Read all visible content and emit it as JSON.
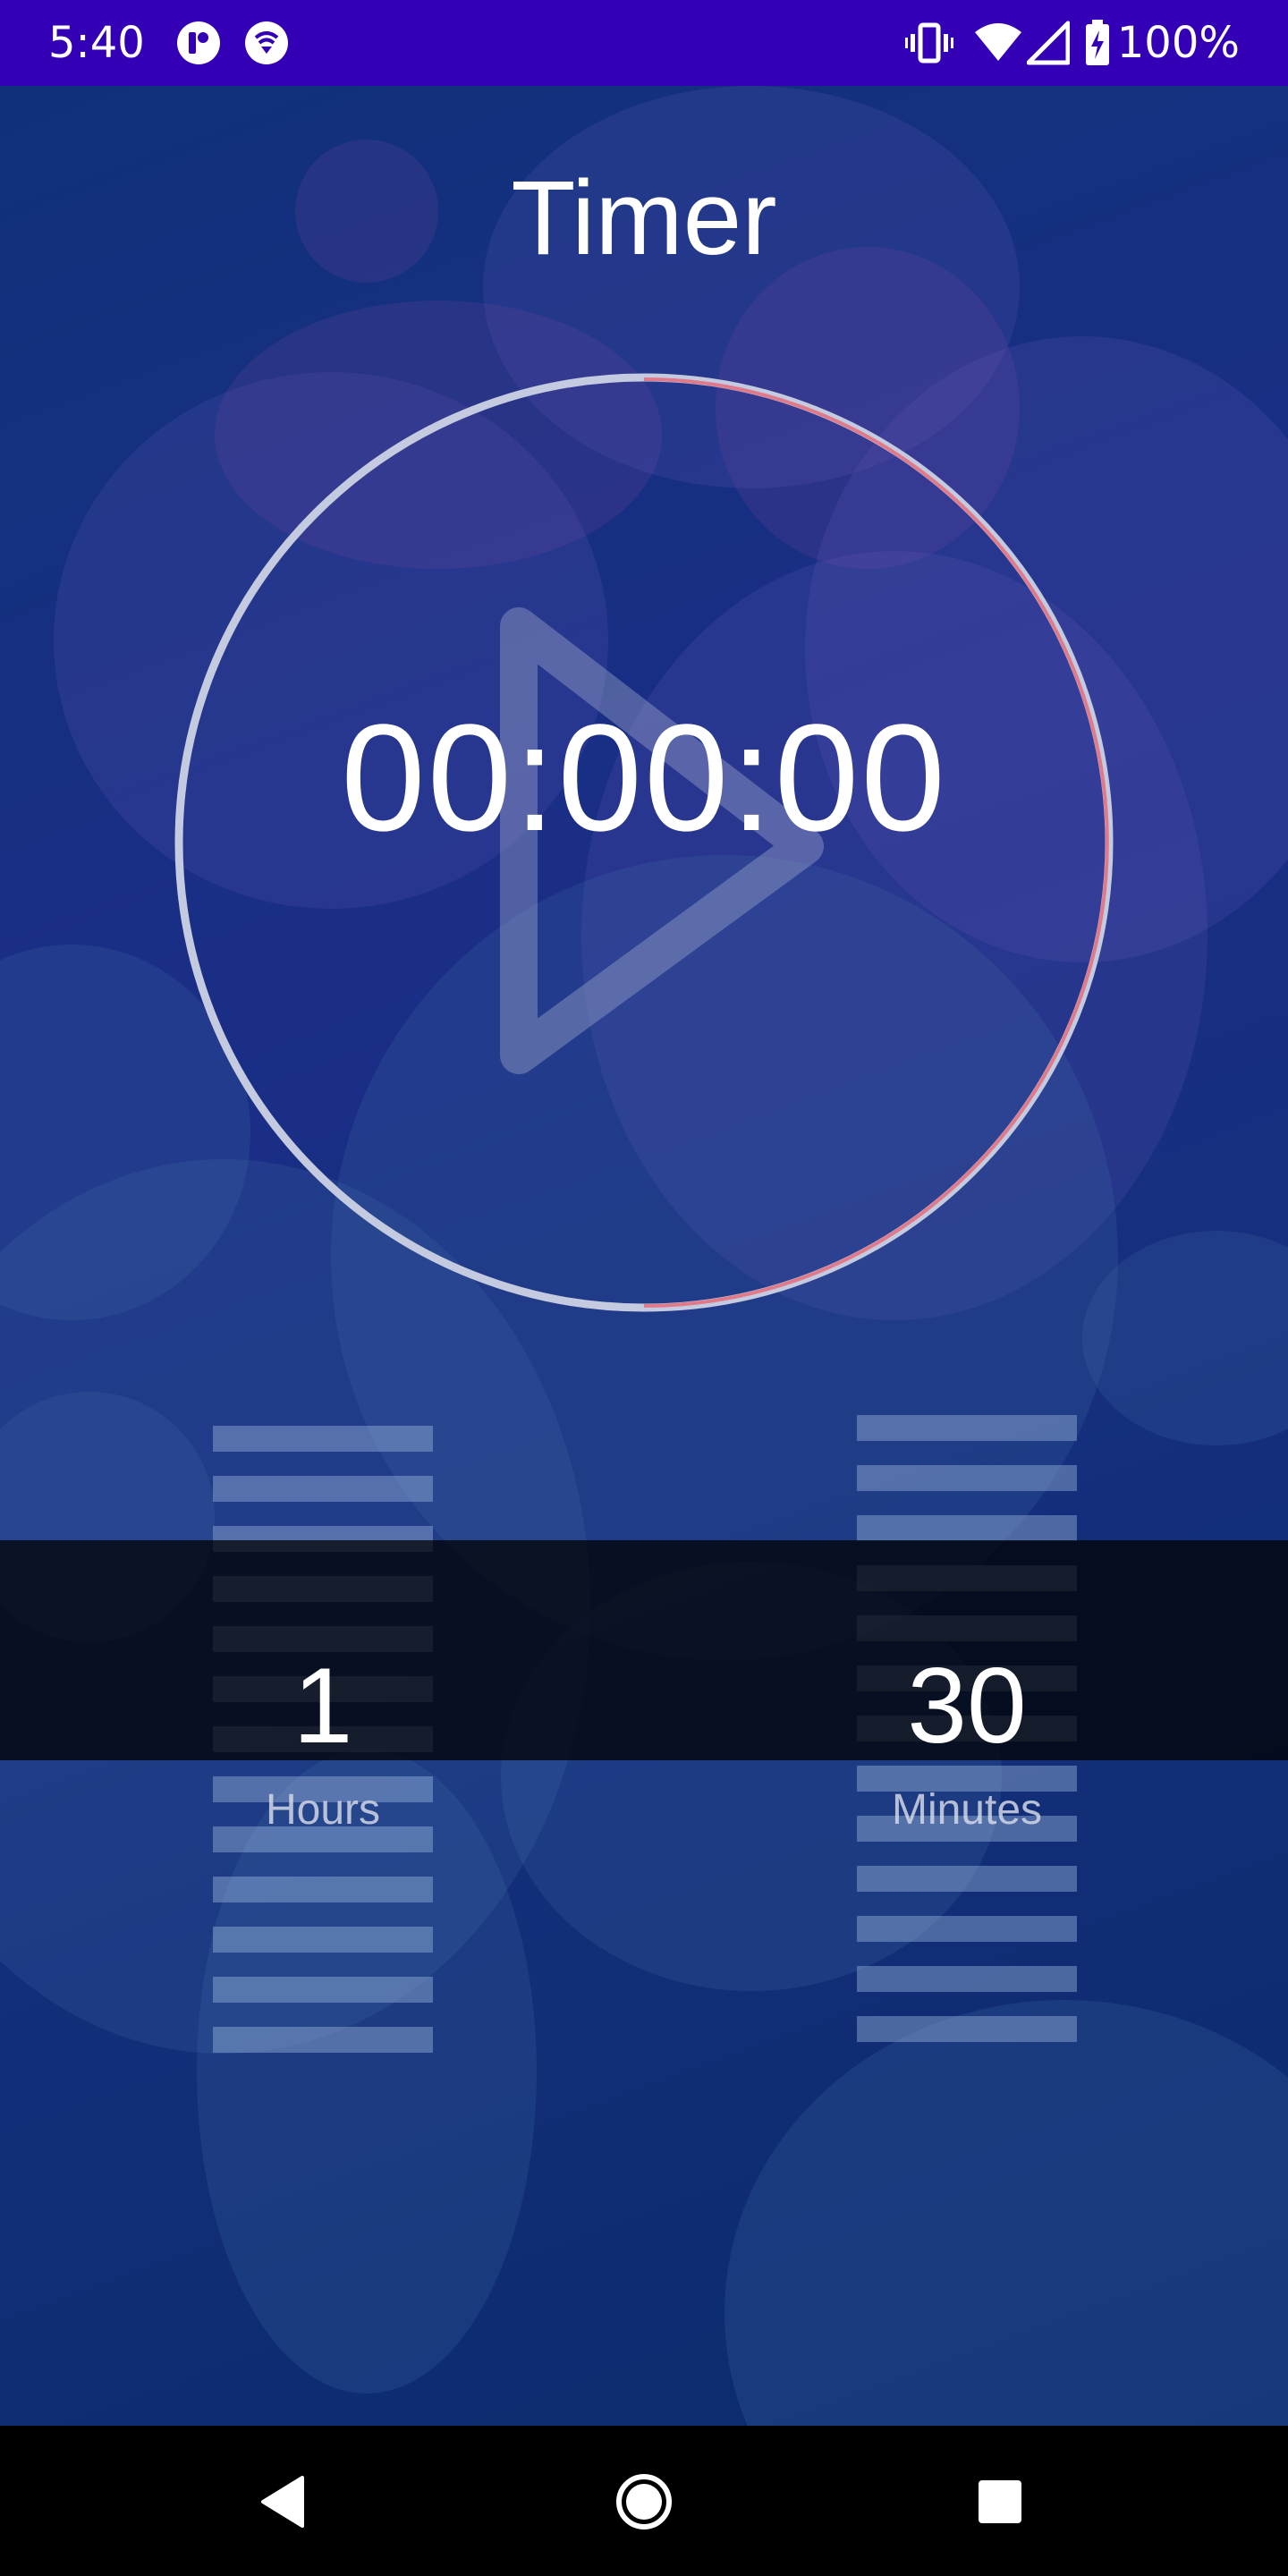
{
  "status_bar": {
    "time": "5:40",
    "battery_percent": "100%",
    "icons": [
      "app-notification-icon",
      "vpn-shield-icon",
      "vibrate-icon",
      "wifi-icon",
      "cell-signal-icon",
      "battery-charging-icon"
    ],
    "background_color": "#3300b5"
  },
  "page": {
    "title": "Timer"
  },
  "timer": {
    "display": "00:00:00",
    "play_icon": "play-icon",
    "ring_color": "#c4cbe0",
    "progress_color": "#e07a8a"
  },
  "pickers": {
    "hours": {
      "value": "1",
      "label": "Hours"
    },
    "minutes": {
      "value": "30",
      "label": "Minutes"
    }
  },
  "nav_bar": {
    "buttons": [
      "back-icon",
      "home-icon",
      "recents-icon"
    ]
  }
}
